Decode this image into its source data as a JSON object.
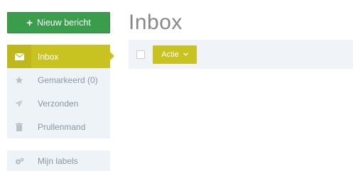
{
  "compose": {
    "label": "Nieuw bericht",
    "icon": "plus-icon"
  },
  "page": {
    "title": "Inbox"
  },
  "sidebar": {
    "items": [
      {
        "label": "Inbox",
        "icon": "envelope-icon",
        "active": true
      },
      {
        "label": "Gemarkeerd (0)",
        "icon": "star-icon",
        "active": false
      },
      {
        "label": "Verzonden",
        "icon": "paper-plane-icon",
        "active": false
      },
      {
        "label": "Prullenmand",
        "icon": "trash-icon",
        "active": false
      }
    ],
    "labels": {
      "label": "Mijn labels",
      "icon": "gears-icon"
    }
  },
  "toolbar": {
    "action_label": "Actie",
    "action_icon": "chevron-down-icon"
  },
  "colors": {
    "compose_green": "#3a9d4b",
    "accent_olive": "#c9c322",
    "sidebar_bg": "#eef3f8",
    "title_gray": "#888888"
  }
}
